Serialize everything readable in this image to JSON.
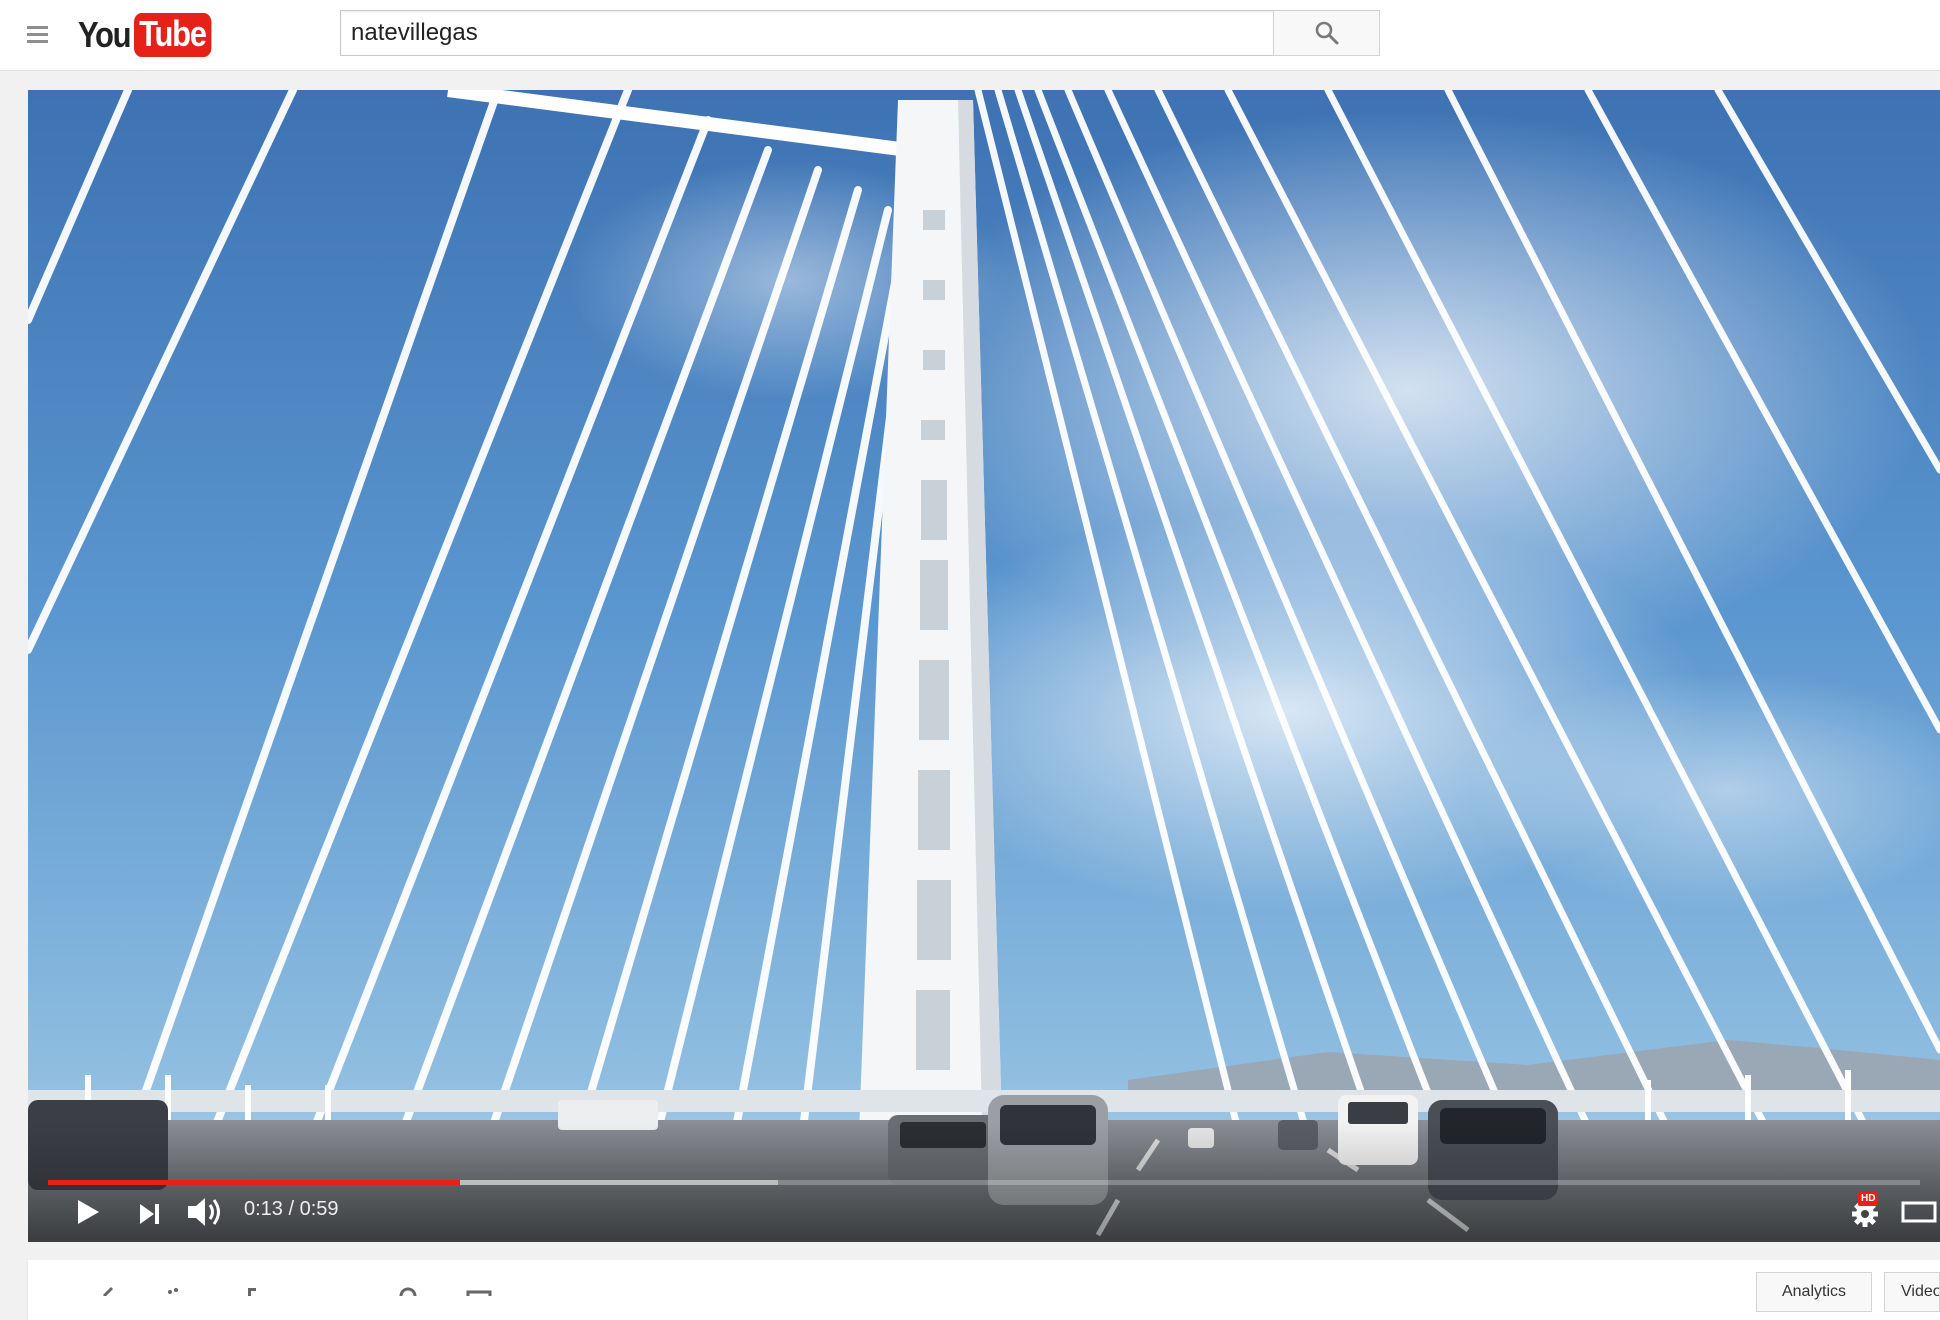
{
  "masthead": {
    "menu_icon": "hamburger-menu-icon",
    "logo": {
      "you": "You",
      "tube": "Tube",
      "brand_color": "#e62117"
    },
    "search": {
      "value": "natevillegas",
      "button_icon": "search-icon"
    }
  },
  "player": {
    "current_time": "0:13",
    "duration": "0:59",
    "time_separator": " / ",
    "progress_fraction": 0.22,
    "buffered_fraction": 0.39,
    "hd_badge": "HD",
    "icons": {
      "play": "play-icon",
      "next": "next-icon",
      "volume": "volume-icon",
      "settings": "gear-icon",
      "theater": "theater-mode-icon"
    },
    "colors": {
      "progress": "#e62117"
    }
  },
  "actions": {
    "analytics_label": "Analytics",
    "videos_label": "Video Manager"
  }
}
